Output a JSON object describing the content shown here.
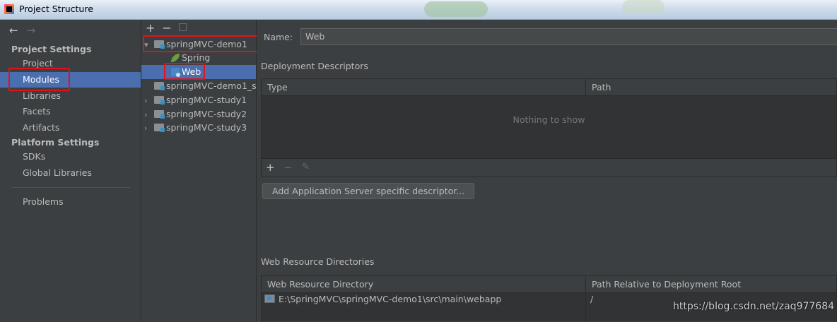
{
  "window": {
    "title": "Project Structure"
  },
  "nav": {
    "back": "←",
    "forward": "→"
  },
  "sidebar": {
    "project_settings_header": "Project Settings",
    "project_items": [
      "Project",
      "Modules",
      "Libraries",
      "Facets",
      "Artifacts"
    ],
    "platform_settings_header": "Platform Settings",
    "platform_items": [
      "SDKs",
      "Global Libraries"
    ],
    "problems": "Problems",
    "selected": "Modules"
  },
  "module_toolbar": {
    "add": "+",
    "remove": "−"
  },
  "modules_tree": {
    "root": "springMVC-demo1",
    "children": [
      "Spring",
      "Web"
    ],
    "others": [
      "springMVC-demo1_s",
      "springMVC-study1",
      "springMVC-study2",
      "springMVC-study3"
    ],
    "selected": "Web"
  },
  "details": {
    "name_label": "Name:",
    "name_value": "Web",
    "deployment_descriptors": {
      "title": "Deployment Descriptors",
      "columns": [
        "Type",
        "Path"
      ],
      "empty_text": "Nothing to show",
      "toolbar": {
        "add": "+",
        "remove": "−",
        "edit": "✎"
      },
      "add_button": "Add Application Server specific descriptor..."
    },
    "web_resource": {
      "title": "Web Resource Directories",
      "columns": [
        "Web Resource Directory",
        "Path Relative to Deployment Root"
      ],
      "rows": [
        {
          "directory": "E:\\SpringMVC\\springMVC-demo1\\src\\main\\webapp",
          "path": "/"
        }
      ]
    }
  },
  "watermark": "https://blog.csdn.net/zaq977684",
  "colors": {
    "selection": "#4b6eaf",
    "highlight": "#e2121a",
    "background": "#3c3f41"
  }
}
